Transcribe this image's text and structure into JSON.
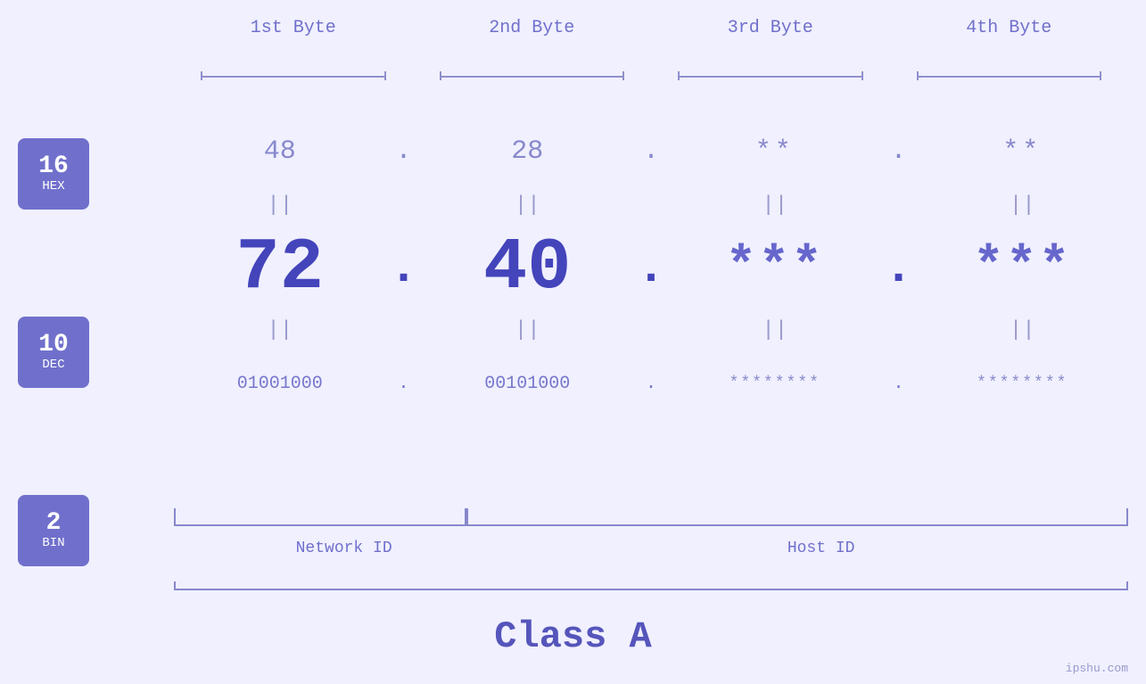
{
  "page": {
    "background": "#f0f0ff",
    "watermark": "ipshu.com"
  },
  "headers": {
    "byte1": "1st Byte",
    "byte2": "2nd Byte",
    "byte3": "3rd Byte",
    "byte4": "4th Byte"
  },
  "bases": [
    {
      "num": "16",
      "name": "HEX"
    },
    {
      "num": "10",
      "name": "DEC"
    },
    {
      "num": "2",
      "name": "BIN"
    }
  ],
  "rows": {
    "hex": {
      "b1": "48",
      "b2": "28",
      "b3": "**",
      "b4": "**"
    },
    "dec": {
      "b1": "72",
      "b2": "40",
      "b3": "***",
      "b4": "***"
    },
    "bin": {
      "b1": "01001000",
      "b2": "00101000",
      "b3": "********",
      "b4": "********"
    }
  },
  "labels": {
    "network_id": "Network ID",
    "host_id": "Host ID",
    "class": "Class A"
  },
  "separators": {
    "dot": ".",
    "eq": "||"
  }
}
